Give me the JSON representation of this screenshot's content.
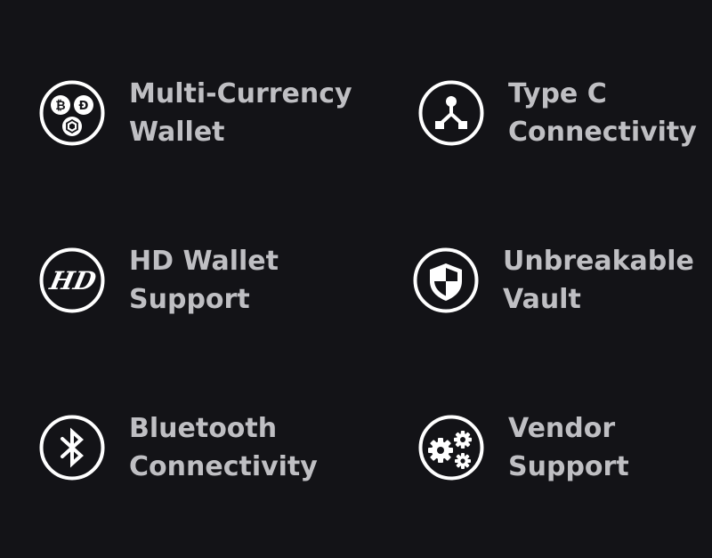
{
  "features": [
    {
      "icon": "multi-currency-coins-icon",
      "line1": "Multi-Currency",
      "line2": "Wallet"
    },
    {
      "icon": "type-c-usb-icon",
      "line1": "Type C",
      "line2": "Connectivity"
    },
    {
      "icon": "hd-wallet-icon",
      "line1": "HD Wallet",
      "line2": "Support",
      "icon_text": "HD"
    },
    {
      "icon": "shield-icon",
      "line1": "Unbreakable",
      "line2": "Vault"
    },
    {
      "icon": "bluetooth-icon",
      "line1": "Bluetooth",
      "line2": "Connectivity"
    },
    {
      "icon": "gears-icon",
      "line1": "Vendor",
      "line2": "Support"
    }
  ],
  "colors": {
    "background": "#131317",
    "text": "#bfbfc3",
    "icon": "#ffffff"
  }
}
